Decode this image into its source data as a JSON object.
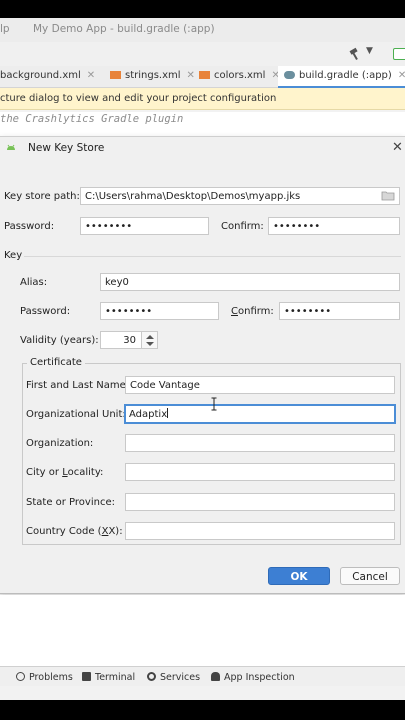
{
  "ide": {
    "menu_fragment": "lp",
    "title": "My Demo App - build.gradle (:app)"
  },
  "tabs": [
    {
      "label": "background.xml",
      "active": false
    },
    {
      "label": "strings.xml",
      "active": false
    },
    {
      "label": "colors.xml",
      "active": false
    },
    {
      "label": "build.gradle (:app)",
      "active": true
    }
  ],
  "banner": {
    "text": "cture dialog to view and edit your project configuration"
  },
  "code": {
    "line1": "the Crashlytics Gradle plugin",
    "line2": "     ... .. . ... ... .. ......"
  },
  "dialog": {
    "title": "New Key Store",
    "key_store_path": {
      "label": "Key store path:",
      "value": "C:\\Users\\rahma\\Desktop\\Demos\\myapp.jks"
    },
    "password": {
      "label": "Password:",
      "value": "••••••••"
    },
    "confirm": {
      "label": "Confirm:",
      "value": "••••••••"
    },
    "key_section": "Key",
    "alias": {
      "label": "Alias:",
      "value": "key0"
    },
    "key_password": {
      "label": "Password:",
      "value": "••••••••"
    },
    "key_confirm": {
      "label": "Confirm:",
      "value": "••••••••"
    },
    "validity": {
      "label": "Validity (years):",
      "value": "30"
    },
    "certificate": {
      "title": "Certificate",
      "first_last_name": {
        "label": "First and Last Name:",
        "value": "Code Vantage"
      },
      "org_unit": {
        "label": "Organizational Unit:",
        "value": "Adaptix"
      },
      "organization": {
        "label": "Organization:",
        "value": ""
      },
      "city": {
        "label": "City or Locality:",
        "value": ""
      },
      "state": {
        "label": "State or Province:",
        "value": ""
      },
      "country": {
        "label": "Country Code (XX):",
        "value": ""
      }
    },
    "ok_label": "OK",
    "cancel_label": "Cancel"
  },
  "toolwindows": [
    {
      "label": "Problems",
      "icon": "problems-icon"
    },
    {
      "label": "Terminal",
      "icon": "terminal-icon"
    },
    {
      "label": "Services",
      "icon": "services-icon"
    },
    {
      "label": "App Inspection",
      "icon": "app-inspection-icon"
    }
  ],
  "colors": {
    "accent": "#3d7fd3",
    "focus": "#4b8dd6",
    "banner": "#fff4cc"
  }
}
